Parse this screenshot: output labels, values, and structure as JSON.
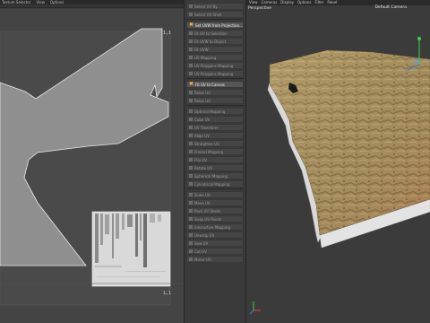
{
  "uv_editor": {
    "menu": [
      "Texture Selector",
      "View",
      "Options"
    ],
    "corner_label": "1,1",
    "mesh_color": "#8f8f8f",
    "mesh_edge_color": "#e8e8e8",
    "atlas_color": "#d9d9d9"
  },
  "tool_panel": {
    "items": [
      {
        "label": "Select UV By..."
      },
      {
        "label": "Select UV Shell"
      },
      {
        "label": "Set UVW from Projection...",
        "active": true,
        "icon": "projection-icon"
      },
      {
        "label": "Fit UV to Selection"
      },
      {
        "label": "Fit UVW to Object"
      },
      {
        "label": "Fit UVW"
      },
      {
        "label": "UV Mapping"
      },
      {
        "label": "UV Polygons Mapping"
      },
      {
        "label": "UV Polygons Mapping"
      },
      {
        "label": "Fit UV to Canvas",
        "active": true,
        "icon": "fit-canvas-icon"
      },
      {
        "label": "Relax UV"
      },
      {
        "label": "Relax UV"
      },
      {
        "label": "Optimal Mapping"
      },
      {
        "label": "Cube UV"
      },
      {
        "label": "UV Transform"
      },
      {
        "label": "Align UV"
      },
      {
        "label": "Straighten UV"
      },
      {
        "label": "Frontal Mapping"
      },
      {
        "label": "Flip UV"
      },
      {
        "label": "Rotate UV"
      },
      {
        "label": "Spherical Mapping"
      },
      {
        "label": "Cylindrical Mapping"
      },
      {
        "label": "Scale UV"
      },
      {
        "label": "Move UV"
      },
      {
        "label": "Pack UV Shells"
      },
      {
        "label": "Snap UV Points"
      },
      {
        "label": "Interactive Mapping"
      },
      {
        "label": "Unwrap UV"
      },
      {
        "label": "Sew UV"
      },
      {
        "label": "Cut UV"
      },
      {
        "label": "Mirror UV"
      }
    ]
  },
  "viewport": {
    "menu": [
      "View",
      "Cameras",
      "Display",
      "Options",
      "Filter",
      "Panel"
    ],
    "view_name": "Perspective",
    "camera_name": "Default Camera",
    "terrain_colors": [
      "#b29a62",
      "#8d7a4c",
      "#c9b07a",
      "#6d6a48"
    ],
    "side_color": "#d9d9d9"
  }
}
